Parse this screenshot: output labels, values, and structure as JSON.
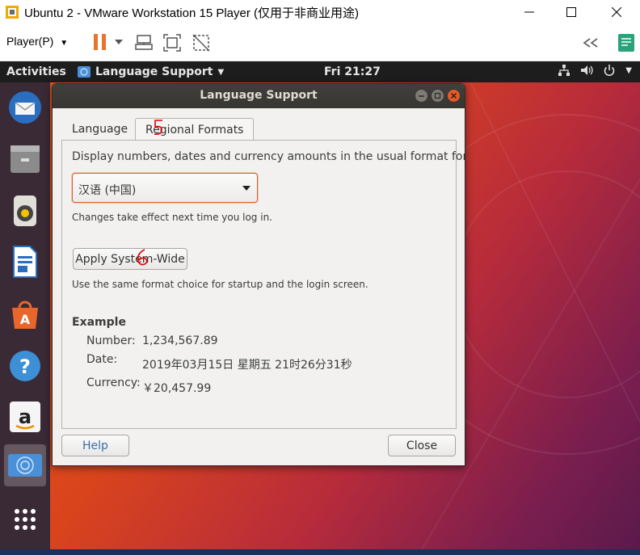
{
  "window": {
    "title": "Ubuntu 2 - VMware Workstation 15 Player (仅用于非商业用途)",
    "icons": [
      "vmware-logo-icon",
      "minimize-icon",
      "maximize-icon",
      "close-icon"
    ]
  },
  "vm_toolbar": {
    "player_menu": "Player(P)",
    "icons": [
      "pause-icon",
      "send-ctrl-alt-del-icon",
      "fullscreen-icon",
      "unity-icon",
      "back-icon",
      "notes-icon"
    ]
  },
  "ubuntu_panel": {
    "activities": "Activities",
    "app_menu": "Language Support",
    "clock": "Fri 21:27",
    "tray_icons": [
      "network-icon",
      "volume-icon",
      "power-icon"
    ]
  },
  "dock": {
    "items": [
      "thunderbird-icon",
      "files-icon",
      "rhythmbox-icon",
      "libreoffice-writer-icon",
      "software-center-icon",
      "help-icon",
      "amazon-icon",
      "language-support-icon",
      "show-apps-icon"
    ]
  },
  "dialog": {
    "title": "Language Support",
    "tabs": [
      "Language",
      "Regional Formats"
    ],
    "active_tab": "Regional Formats",
    "prompt": "Display numbers, dates and currency amounts in the usual format for:",
    "format_select": "汉语 (中国)",
    "changes_note": "Changes take effect next time you log in.",
    "apply_button": "Apply System-Wide",
    "apply_note": "Use the same format choice for startup and the login screen.",
    "example": {
      "heading": "Example",
      "number_label": "Number:",
      "number_value": "1,234,567.89",
      "date_label": "Date:",
      "date_value": "2019年03月15日 星期五 21时26分31秒",
      "currency_label": "Currency:",
      "currency_value": "￥20,457.99"
    },
    "help_button": "Help",
    "close_button": "Close"
  },
  "annotations": [
    "5",
    "6"
  ],
  "colors": {
    "accent": "#e95420",
    "panel": "#1d1d1d",
    "dialog_bg": "#f2f1f0",
    "annotation": "#e00000"
  }
}
